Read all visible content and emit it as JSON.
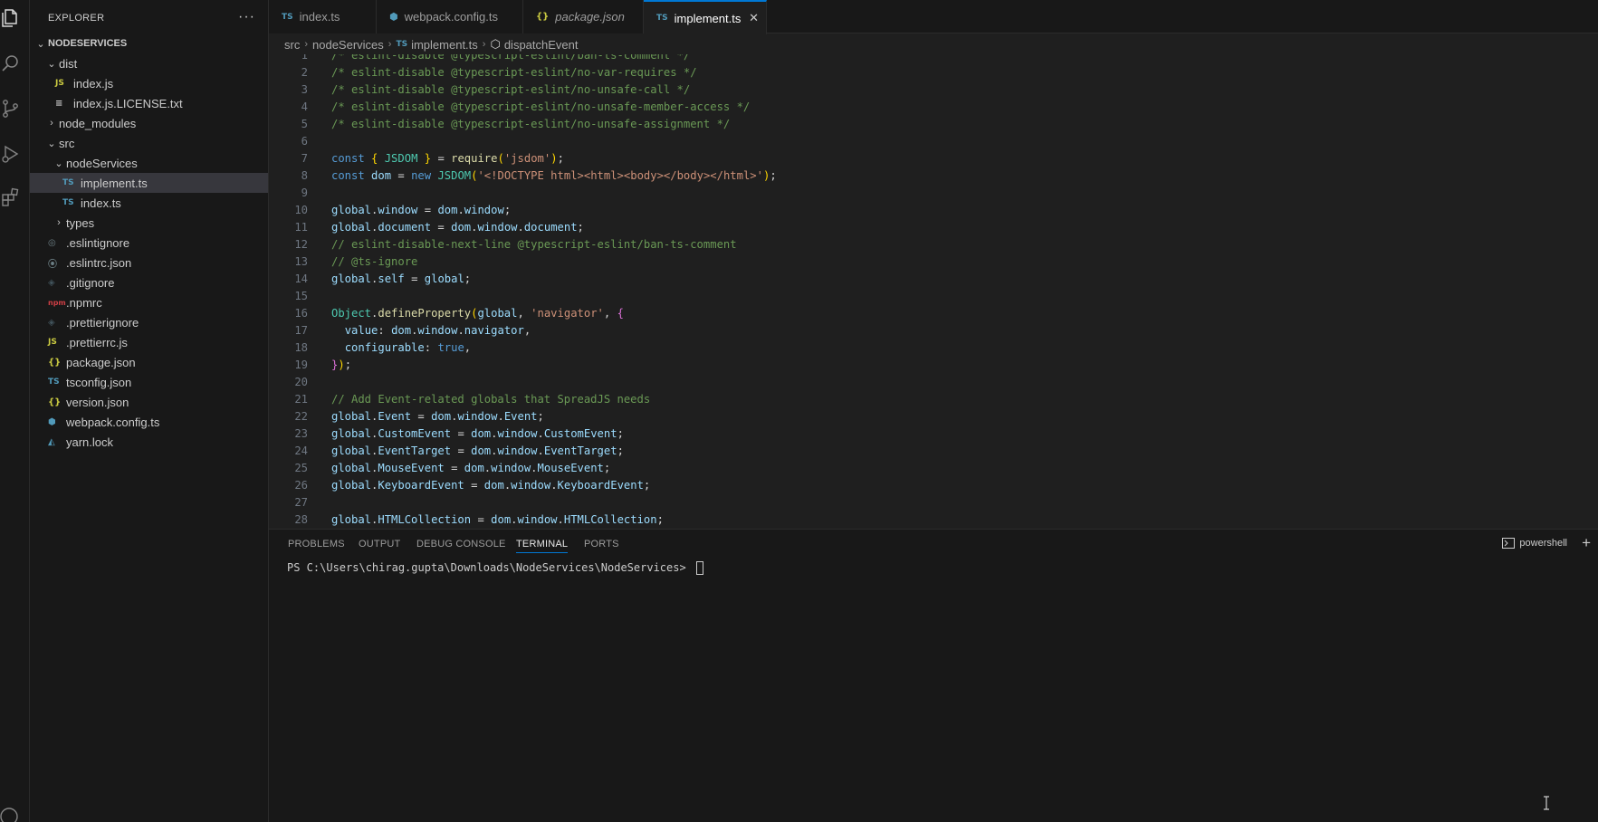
{
  "explorer": {
    "title": "EXPLORER",
    "more": "···",
    "project": "NODESERVICES",
    "items": [
      {
        "label": "dist",
        "kind": "folder-open",
        "depth": 1
      },
      {
        "label": "index.js",
        "kind": "js",
        "depth": 2
      },
      {
        "label": "index.js.LICENSE.txt",
        "kind": "txt",
        "depth": 2
      },
      {
        "label": "node_modules",
        "kind": "folder",
        "depth": 1
      },
      {
        "label": "src",
        "kind": "folder-open",
        "depth": 1
      },
      {
        "label": "nodeServices",
        "kind": "folder-open",
        "depth": 2
      },
      {
        "label": "implement.ts",
        "kind": "ts",
        "depth": 3,
        "selected": true
      },
      {
        "label": "index.ts",
        "kind": "ts",
        "depth": 3
      },
      {
        "label": "types",
        "kind": "folder",
        "depth": 2
      },
      {
        "label": ".eslintignore",
        "kind": "eslint",
        "depth": 1
      },
      {
        "label": ".eslintrc.json",
        "kind": "gear",
        "depth": 1
      },
      {
        "label": ".gitignore",
        "kind": "git",
        "depth": 1
      },
      {
        "label": ".npmrc",
        "kind": "npm",
        "depth": 1
      },
      {
        "label": ".prettierignore",
        "kind": "git",
        "depth": 1
      },
      {
        "label": ".prettierrc.js",
        "kind": "js",
        "depth": 1
      },
      {
        "label": "package.json",
        "kind": "json",
        "depth": 1
      },
      {
        "label": "tsconfig.json",
        "kind": "tsconfig",
        "depth": 1
      },
      {
        "label": "version.json",
        "kind": "json",
        "depth": 1
      },
      {
        "label": "webpack.config.ts",
        "kind": "wp",
        "depth": 1
      },
      {
        "label": "yarn.lock",
        "kind": "yarn",
        "depth": 1
      }
    ]
  },
  "tabs": [
    {
      "label": "index.ts",
      "icon": "TS",
      "italic": false,
      "active": false
    },
    {
      "label": "webpack.config.ts",
      "icon": "⬢",
      "italic": false,
      "active": false
    },
    {
      "label": "package.json",
      "icon": "{}",
      "italic": true,
      "active": false
    },
    {
      "label": "implement.ts",
      "icon": "TS",
      "italic": false,
      "active": true,
      "close": "✕"
    }
  ],
  "breadcrumb": {
    "parts": [
      "src",
      "nodeServices",
      "implement.ts",
      "dispatchEvent"
    ],
    "file_icon": "TS",
    "symbol_icon": "⬡"
  },
  "code_lines": [
    "/* eslint-disable @typescript-eslint/ban-ts-comment */",
    "/* eslint-disable @typescript-eslint/no-var-requires */",
    "/* eslint-disable @typescript-eslint/no-unsafe-call */",
    "/* eslint-disable @typescript-eslint/no-unsafe-member-access */",
    "/* eslint-disable @typescript-eslint/no-unsafe-assignment */",
    "",
    "const { JSDOM } = require('jsdom');",
    "const dom = new JSDOM('<!DOCTYPE html><html><body></body></html>');",
    "",
    "global.window = dom.window;",
    "global.document = dom.window.document;",
    "// eslint-disable-next-line @typescript-eslint/ban-ts-comment",
    "// @ts-ignore",
    "global.self = global;",
    "",
    "Object.defineProperty(global, 'navigator', {",
    "  value: dom.window.navigator,",
    "  configurable: true,",
    "});",
    "",
    "// Add Event-related globals that SpreadJS needs",
    "global.Event = dom.window.Event;",
    "global.CustomEvent = dom.window.CustomEvent;",
    "global.EventTarget = dom.window.EventTarget;",
    "global.MouseEvent = dom.window.MouseEvent;",
    "global.KeyboardEvent = dom.window.KeyboardEvent;",
    "",
    "global.HTMLCollection = dom.window.HTMLCollection;"
  ],
  "panel": {
    "tabs": [
      "PROBLEMS",
      "OUTPUT",
      "DEBUG CONSOLE",
      "TERMINAL",
      "PORTS"
    ],
    "active_tab": "TERMINAL",
    "prompt": "PS C:\\Users\\chirag.gupta\\Downloads\\NodeServices\\NodeServices> ",
    "shell": "powershell",
    "plus": "+"
  },
  "colors": {
    "accent": "#0078d4",
    "editor_bg": "#1f1f1f",
    "sidebar_bg": "#181818"
  }
}
